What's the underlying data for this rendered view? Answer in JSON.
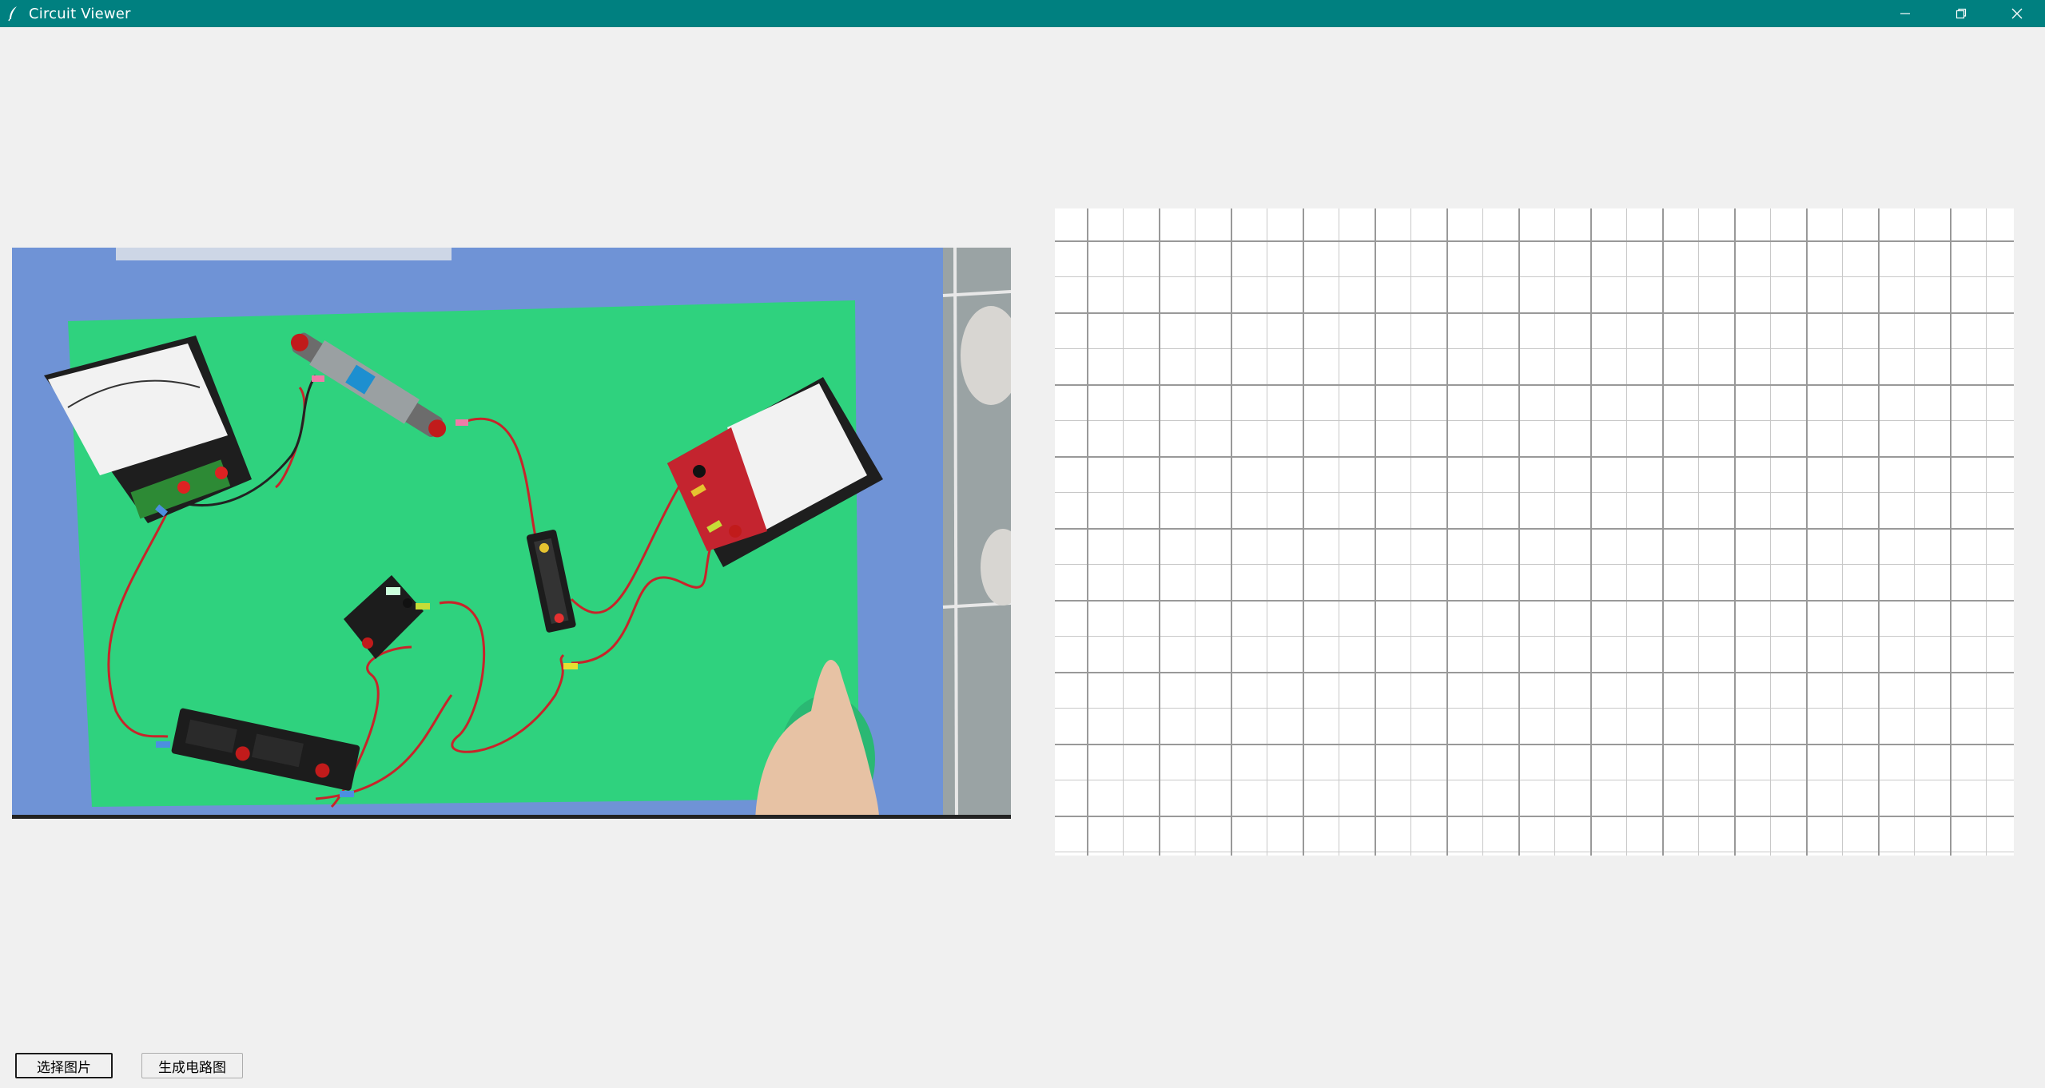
{
  "window": {
    "title": "Circuit Viewer",
    "titlebar_color": "#008080",
    "controls": [
      "minimize-icon",
      "restore-icon",
      "close-icon"
    ]
  },
  "photo": {
    "description_icon": "circuit-photo",
    "background_color": "#6f93d6",
    "board_color": "#2fd27e"
  },
  "canvas": {
    "background": "#ffffff",
    "grid": true
  },
  "buttons": {
    "select_image": "选择图片",
    "generate_circuit": "生成电路图"
  }
}
